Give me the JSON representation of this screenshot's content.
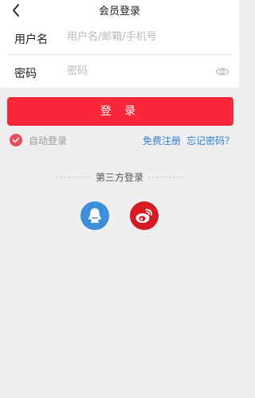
{
  "header": {
    "title": "会员登录",
    "back_icon": "chevron-left-icon"
  },
  "form": {
    "username_label": "用户名",
    "username_placeholder": "用户名/邮箱/手机号",
    "username_value": "",
    "password_label": "密码",
    "password_placeholder": "密码",
    "password_value": "",
    "password_toggle_icon": "eye-icon"
  },
  "login_button": "登 录",
  "options": {
    "auto_login_label": "自动登录",
    "auto_login_checked": true,
    "register_link": "免费注册",
    "forgot_link": "忘记密码？"
  },
  "third_party": {
    "title": "第三方登录",
    "providers": [
      {
        "name": "qq",
        "icon": "qq-icon",
        "color": "#3d8fd9"
      },
      {
        "name": "weibo",
        "icon": "weibo-icon",
        "color": "#d51a23"
      }
    ]
  },
  "colors": {
    "accent": "#fa2639",
    "link": "#2f7fd1",
    "checkbox": "#ec4b5b",
    "background": "#efeff1"
  }
}
